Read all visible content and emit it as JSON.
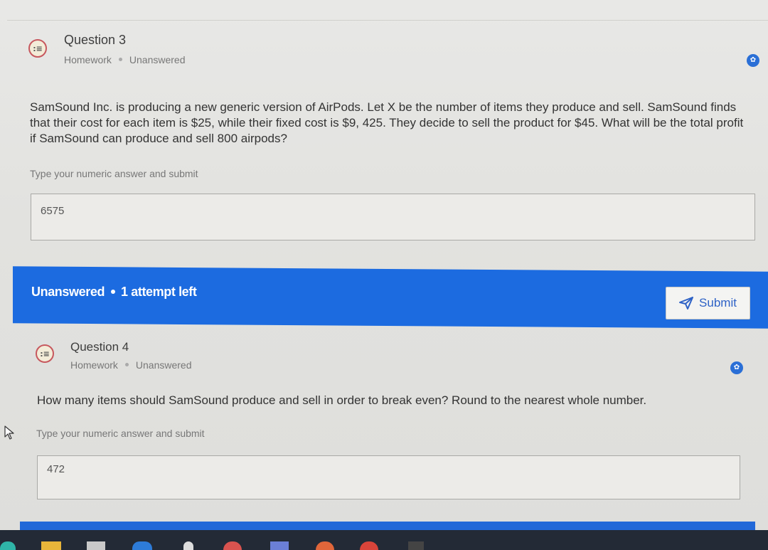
{
  "question3": {
    "icon": "list-icon",
    "title": "Question 3",
    "category": "Homework",
    "status": "Unanswered",
    "text": "SamSound Inc. is producing a new generic version of AirPods. Let X be the number of items they produce and sell. SamSound finds that their cost for each item is $25, while their fixed cost is $9, 425. They decide to sell the product for $45. What will be the total profit if SamSound can produce and sell 800 airpods?",
    "hint": "Type your numeric answer and submit",
    "answer": "6575"
  },
  "status_bar": {
    "status": "Unanswered",
    "attempts": "1 attempt left",
    "submit_label": "Submit",
    "submit_icon": "send-icon",
    "color": "#1c6be0"
  },
  "question4": {
    "icon": "list-icon",
    "title": "Question 4",
    "category": "Homework",
    "status": "Unanswered",
    "text": "How many items should SamSound produce and sell in order to break even? Round to the nearest whole number.",
    "hint": "Type your numeric answer and submit",
    "answer": "472"
  },
  "colors": {
    "accent": "#2a6fd6",
    "icon_border": "#c7585e"
  }
}
